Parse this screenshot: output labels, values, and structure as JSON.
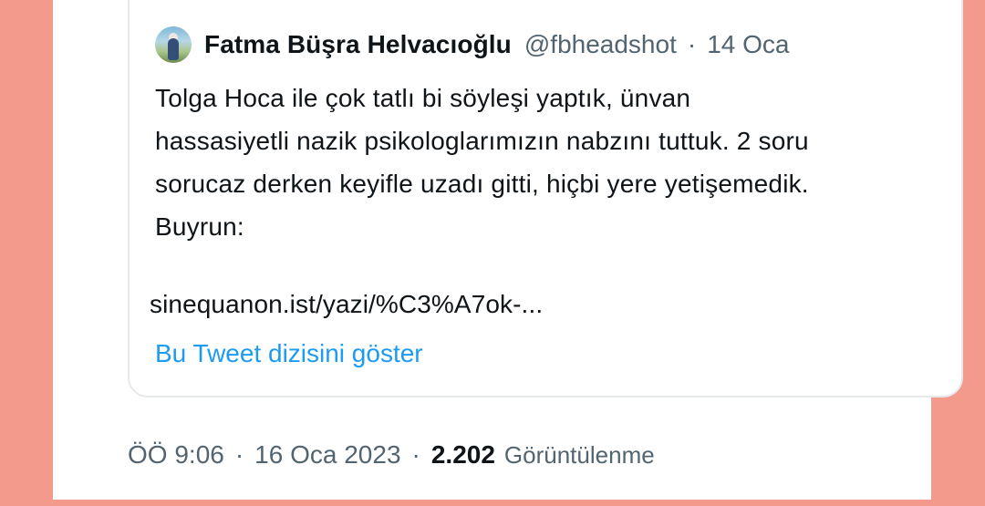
{
  "quoted_tweet": {
    "author_name": "Fatma Büşra Helvacıoğlu",
    "handle": "@fbheadshot",
    "separator": "·",
    "date": "14 Oca",
    "text": "Tolga Hoca ile çok tatlı bi söyleşi yaptık, ünvan\nhassasiyetli nazik psikologlarımızın nabzını tuttuk. 2 soru\nsorucaz derken keyifle uzadı gitti, hiçbi yere yetişemedik.\nBuyrun:",
    "link_text": "sinequanon.ist/yazi/%C3%A7ok-...",
    "thread_link_label": "Bu Tweet dizisini göster"
  },
  "tweet_meta": {
    "time": "ÖÖ 9:06",
    "separator_1": "·",
    "date": "16 Oca 2023",
    "separator_2": "·",
    "views_count": "2.202",
    "views_label": "Görüntülenme"
  },
  "colors": {
    "frame": "#f49a8c",
    "text_primary": "#0f1419",
    "text_secondary": "#536471",
    "link": "#1d9bf0",
    "card_border": "#e6e9ec"
  },
  "icons": {
    "avatar": "profile-photo-avatar"
  }
}
